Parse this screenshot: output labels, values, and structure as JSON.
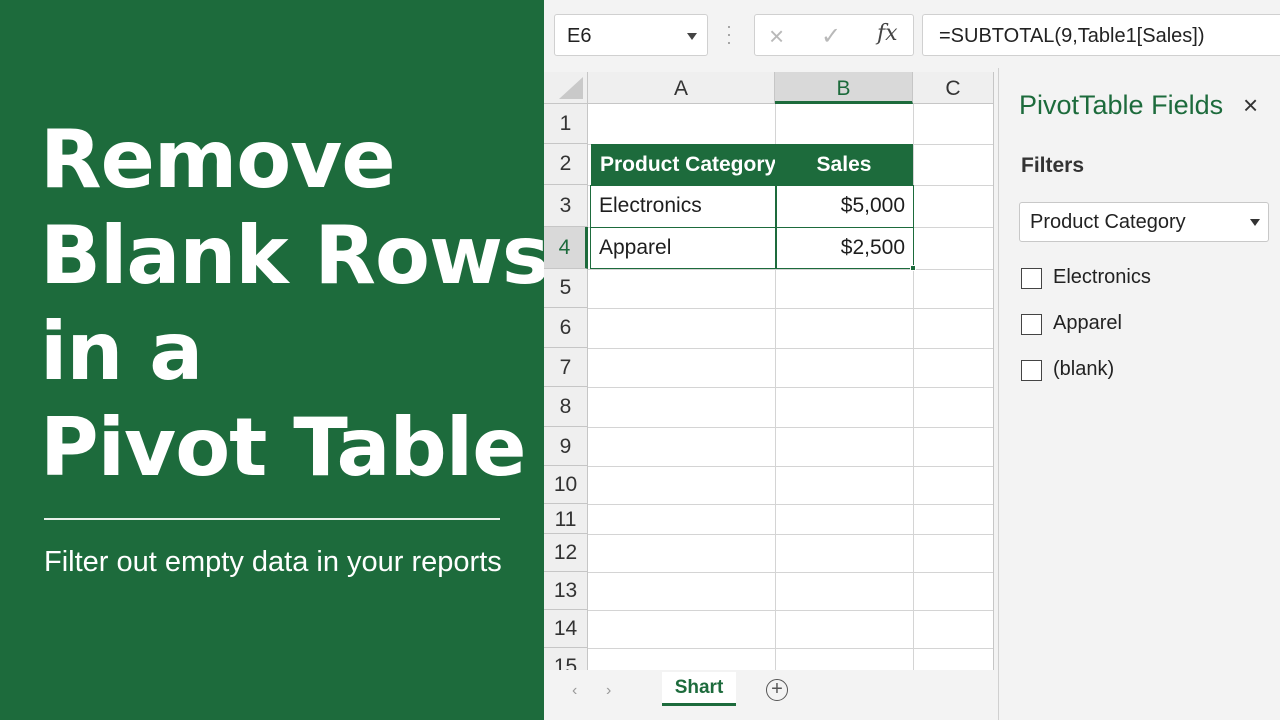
{
  "hero": {
    "title_lines": [
      "Remove",
      "Blank Rows",
      "in a",
      "Pivot Table"
    ],
    "subtitle": "Filter out empty data in your reports"
  },
  "formula_bar": {
    "name_box": "E6",
    "cancel_icon": "×",
    "enter_icon": "✓",
    "fx_label": "fx",
    "formula": "=SUBTOTAL(9,Table1[Sales])"
  },
  "grid": {
    "columns": [
      "A",
      "B",
      "C"
    ],
    "rows": [
      "1",
      "2",
      "3",
      "4",
      "5",
      "6",
      "7",
      "8",
      "9",
      "10",
      "11",
      "12",
      "13",
      "14",
      "15"
    ],
    "table": {
      "headers": [
        "Product Category",
        "Sales"
      ],
      "rows": [
        [
          "Electronics",
          "$5,000"
        ],
        [
          "Apparel",
          "$2,500"
        ]
      ]
    }
  },
  "sheet_tabs": {
    "prev_icon": "‹",
    "next_icon": "›",
    "active": "Shart",
    "add_icon": "+"
  },
  "pivot_panel": {
    "title": "PivotTable Fields",
    "close_icon": "×",
    "filters_label": "Filters",
    "filter_field": "Product Category",
    "items": [
      "Electronics",
      "Apparel",
      "(blank)"
    ]
  },
  "colors": {
    "accent": "#1d6b3c",
    "header_bg": "#efefef"
  }
}
